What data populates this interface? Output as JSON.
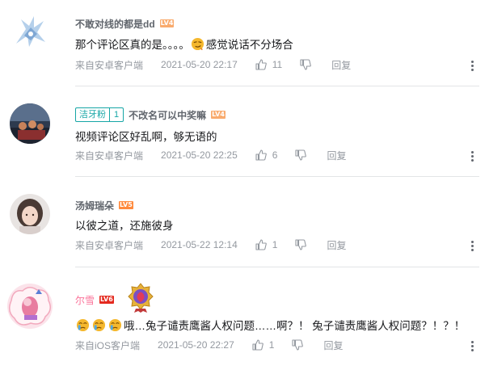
{
  "comments": [
    {
      "username": "不敢对线的都是dd",
      "level": "LV4",
      "text_before": "那个评论区真的是。。。。",
      "text_after": "感觉说话不分场合",
      "source": "来自安卓客户端",
      "time": "2021-05-20 22:17",
      "likes": "11",
      "reply": "回复"
    },
    {
      "fan_badge": "洁牙粉",
      "fan_level": "1",
      "username": "不改名可以中奖嘛",
      "level": "LV4",
      "text": "视频评论区好乱啊，够无语的",
      "source": "来自安卓客户端",
      "time": "2021-05-20 22:25",
      "likes": "6",
      "reply": "回复"
    },
    {
      "username": "汤姆瑞朵",
      "level": "LV5",
      "text": "以彼之道，还施彼身",
      "source": "来自安卓客户端",
      "time": "2021-05-22 12:14",
      "likes": "1",
      "reply": "回复"
    },
    {
      "username": "尔雪",
      "level": "LV6",
      "text": "哦…兔子谴责鹰酱人权问题……啊？！ 兔子谴责鹰酱人权问题？！？！",
      "source": "来自iOS客户端",
      "time": "2021-05-20 22:27",
      "likes": "1",
      "reply": "回复"
    }
  ],
  "colors": {
    "username": "#61666d",
    "vip_username": "#fb7299",
    "meta": "#9499a0",
    "fan_badge": "#16a6a6",
    "divider": "#e3e5e7"
  },
  "icons": [
    "thumbs-up-icon",
    "thumbs-down-icon",
    "more-icon",
    "smirk-emoji-icon",
    "cry-emoji-icon"
  ]
}
